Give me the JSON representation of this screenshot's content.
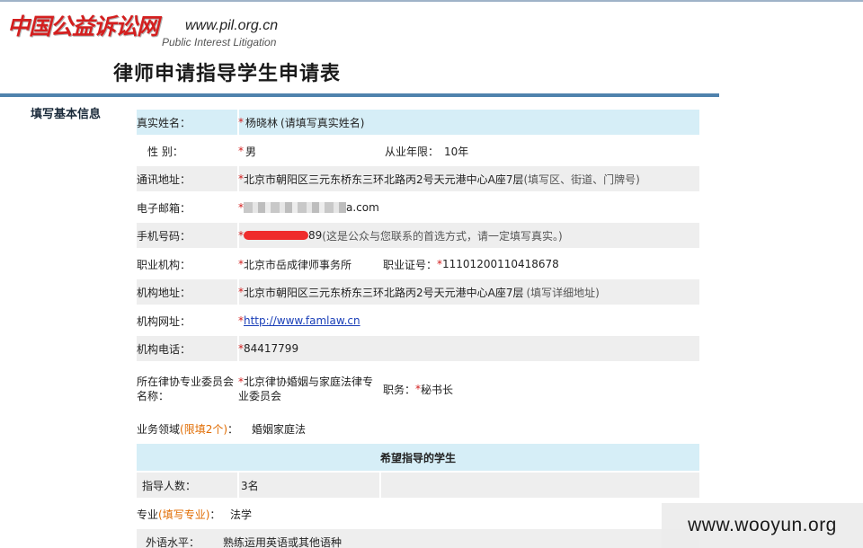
{
  "logo": {
    "main": "中国公益诉讼网",
    "url": "www.pil.org.cn",
    "sub": "Public Interest Litigation"
  },
  "page_title": "律师申请指导学生申请表",
  "section_label": "填写基本信息",
  "fields": {
    "name": {
      "label": "真实姓名：",
      "value": "杨晓林",
      "hint": "(请填写真实姓名)"
    },
    "gender": {
      "label": "性 别：",
      "value": "男",
      "years_label": "从业年限：",
      "years_value": "10年"
    },
    "address": {
      "label": "通讯地址：",
      "value": "北京市朝阳区三元东桥东三环北路丙2号天元港中心A座7层",
      "hint": "(填写区、街道、门牌号)"
    },
    "email": {
      "label": "电子邮箱：",
      "value_tail": "a.com"
    },
    "phone": {
      "label": "手机号码：",
      "value_tail": "89",
      "hint": "(这是公众与您联系的首选方式，请一定填写真实。)"
    },
    "org": {
      "label": "职业机构：",
      "value": "北京市岳成律师事务所",
      "cert_label": "职业证号：",
      "cert_value": "11101200110418678"
    },
    "org_address": {
      "label": "机构地址：",
      "value": "北京市朝阳区三元东桥东三环北路丙2号天元港中心A座7层",
      "hint": "(填写详细地址)"
    },
    "org_site": {
      "label": "机构网址：",
      "value": "http://www.famlaw.cn"
    },
    "org_phone": {
      "label": "机构电话：",
      "value": "84417799"
    },
    "committee": {
      "label": "所在律协专业委员会名称：",
      "value": "北京律协婚姻与家庭法律专业委员会",
      "role_label": "职务：",
      "role_value": "秘书长"
    },
    "domain": {
      "label": "业务领域",
      "label_note": "(限填2个)",
      "label_colon": "：",
      "value": "婚姻家庭法"
    }
  },
  "students_header": "希望指导的学生",
  "students": {
    "count": {
      "label": "指导人数：",
      "value": "3名"
    },
    "major": {
      "label": "专业",
      "label_note": "(填写专业)",
      "label_colon": "：",
      "value": "法学"
    },
    "language": {
      "label": "外语水平：",
      "value": "熟练运用英语或其他语种"
    }
  },
  "star": "*",
  "watermark": "www.wooyun.org",
  "colors": {
    "row_blue": "#d6eef7",
    "row_grey": "#eeeeee",
    "divider": "#4f82ad",
    "required_star": "#d21c1c",
    "note_orange": "#e06b00",
    "logo_red": "#d41f1f"
  }
}
